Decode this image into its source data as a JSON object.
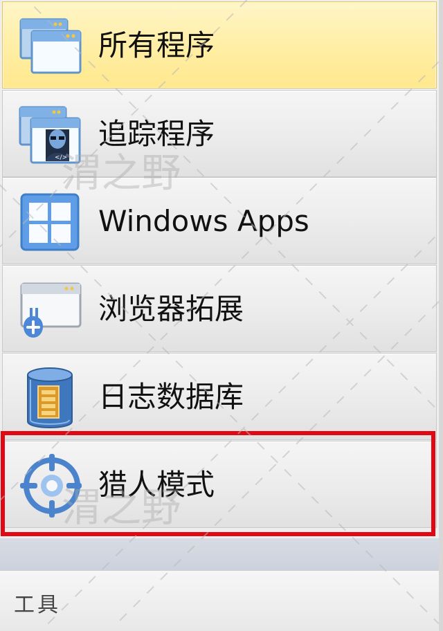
{
  "nav": {
    "items": [
      {
        "label": "所有程序",
        "icon": "windows-stack-icon",
        "selected": true
      },
      {
        "label": "追踪程序",
        "icon": "tracked-program-user-icon",
        "selected": false
      },
      {
        "label": "Windows Apps",
        "icon": "windows-logo-icon",
        "selected": false
      },
      {
        "label": "浏览器拓展",
        "icon": "browser-plugin-icon",
        "selected": false
      },
      {
        "label": "日志数据库",
        "icon": "log-database-icon",
        "selected": false
      },
      {
        "label": "猎人模式",
        "icon": "target-crosshair-icon",
        "selected": false
      }
    ]
  },
  "section": {
    "label": "工具"
  },
  "annotation": {
    "highlight_color": "#e00812"
  },
  "watermark": {
    "text": "渭之野"
  }
}
